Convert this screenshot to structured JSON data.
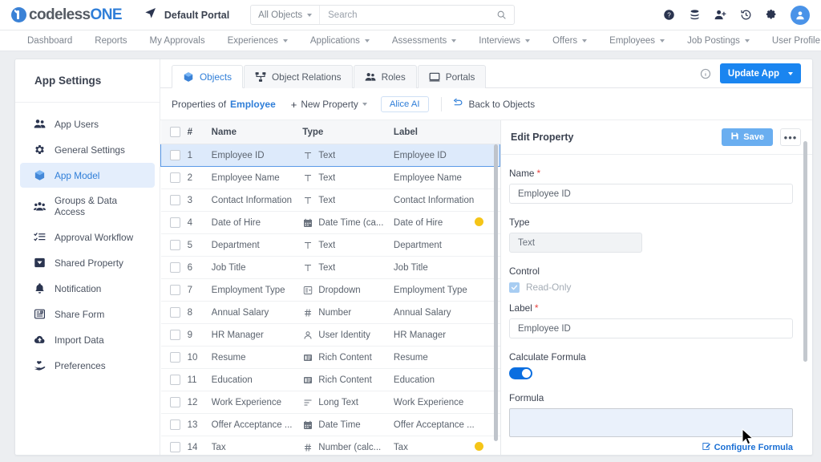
{
  "header": {
    "logo_text_a": "codeless",
    "logo_text_b": "ONE",
    "portal_name": "Default Portal",
    "object_filter": "All Objects",
    "search_placeholder": "Search",
    "icons": [
      "help-circle-icon",
      "database-icon",
      "add-user-icon",
      "history-icon",
      "gear-icon",
      "avatar"
    ]
  },
  "nav": {
    "items": [
      {
        "label": "Dashboard",
        "has_caret": false
      },
      {
        "label": "Reports",
        "has_caret": false
      },
      {
        "label": "My Approvals",
        "has_caret": false
      },
      {
        "label": "Experiences",
        "has_caret": true
      },
      {
        "label": "Applications",
        "has_caret": true
      },
      {
        "label": "Assessments",
        "has_caret": true
      },
      {
        "label": "Interviews",
        "has_caret": true
      },
      {
        "label": "Offers",
        "has_caret": true
      },
      {
        "label": "Employees",
        "has_caret": true
      },
      {
        "label": "Job Postings",
        "has_caret": true
      },
      {
        "label": "User Profile",
        "has_caret": true
      }
    ]
  },
  "sidebar": {
    "title": "App Settings",
    "items": [
      {
        "label": "App Users",
        "icon": "users-icon",
        "active": false
      },
      {
        "label": "General Settings",
        "icon": "gear-icon",
        "active": false
      },
      {
        "label": "App Model",
        "icon": "cube-icon",
        "active": true
      },
      {
        "label": "Groups & Data Access",
        "icon": "group-icon",
        "active": false
      },
      {
        "label": "Approval Workflow",
        "icon": "checklist-icon",
        "active": false
      },
      {
        "label": "Shared Property",
        "icon": "tag-icon",
        "active": false
      },
      {
        "label": "Notification",
        "icon": "bell-icon",
        "active": false
      },
      {
        "label": "Share Form",
        "icon": "form-icon",
        "active": false
      },
      {
        "label": "Import Data",
        "icon": "cloud-upload-icon",
        "active": false
      },
      {
        "label": "Preferences",
        "icon": "hand-heart-icon",
        "active": false
      }
    ]
  },
  "tabs": {
    "items": [
      {
        "label": "Objects",
        "icon": "cube-icon",
        "active": true
      },
      {
        "label": "Object Relations",
        "icon": "relations-icon",
        "active": false
      },
      {
        "label": "Roles",
        "icon": "users-icon",
        "active": false
      },
      {
        "label": "Portals",
        "icon": "monitor-icon",
        "active": false
      }
    ],
    "update_app_label": "Update App"
  },
  "toolbar": {
    "properties_of_label": "Properties of",
    "object_name": "Employee",
    "new_property_label": "New Property",
    "alice_label": "Alice AI",
    "back_label": "Back to Objects"
  },
  "table": {
    "columns": [
      "#",
      "Name",
      "Type",
      "Label"
    ],
    "rows": [
      {
        "num": "1",
        "name": "Employee ID",
        "type": "Text",
        "type_icon": "text-icon",
        "label": "Employee ID",
        "flag": false,
        "selected": true
      },
      {
        "num": "2",
        "name": "Employee Name",
        "type": "Text",
        "type_icon": "text-icon",
        "label": "Employee Name",
        "flag": false,
        "selected": false
      },
      {
        "num": "3",
        "name": "Contact Information",
        "type": "Text",
        "type_icon": "text-icon",
        "label": "Contact Information",
        "flag": false,
        "selected": false
      },
      {
        "num": "4",
        "name": "Date of Hire",
        "type": "Date Time (ca...",
        "type_icon": "calendar-icon",
        "label": "Date of Hire",
        "flag": true,
        "selected": false
      },
      {
        "num": "5",
        "name": "Department",
        "type": "Text",
        "type_icon": "text-icon",
        "label": "Department",
        "flag": false,
        "selected": false
      },
      {
        "num": "6",
        "name": "Job Title",
        "type": "Text",
        "type_icon": "text-icon",
        "label": "Job Title",
        "flag": false,
        "selected": false
      },
      {
        "num": "7",
        "name": "Employment Type",
        "type": "Dropdown",
        "type_icon": "dropdown-icon",
        "label": "Employment Type",
        "flag": false,
        "selected": false
      },
      {
        "num": "8",
        "name": "Annual Salary",
        "type": "Number",
        "type_icon": "number-icon",
        "label": "Annual Salary",
        "flag": false,
        "selected": false
      },
      {
        "num": "9",
        "name": "HR Manager",
        "type": "User Identity",
        "type_icon": "person-icon",
        "label": "HR Manager",
        "flag": false,
        "selected": false
      },
      {
        "num": "10",
        "name": "Resume",
        "type": "Rich Content",
        "type_icon": "rich-text-icon",
        "label": "Resume",
        "flag": false,
        "selected": false
      },
      {
        "num": "11",
        "name": "Education",
        "type": "Rich Content",
        "type_icon": "rich-text-icon",
        "label": "Education",
        "flag": false,
        "selected": false
      },
      {
        "num": "12",
        "name": "Work Experience",
        "type": "Long Text",
        "type_icon": "long-text-icon",
        "label": "Work Experience",
        "flag": false,
        "selected": false
      },
      {
        "num": "13",
        "name": "Offer Acceptance ...",
        "type": "Date Time",
        "type_icon": "calendar-icon",
        "label": "Offer Acceptance ...",
        "flag": false,
        "selected": false
      },
      {
        "num": "14",
        "name": "Tax",
        "type": "Number (calc...",
        "type_icon": "number-icon",
        "label": "Tax",
        "flag": true,
        "selected": false
      }
    ]
  },
  "panel": {
    "title": "Edit Property",
    "save_label": "Save",
    "more_label": "•••",
    "fields": {
      "name_label": "Name",
      "name_value": "Employee ID",
      "type_label": "Type",
      "type_value": "Text",
      "control_label": "Control",
      "readonly_label": "Read-Only",
      "label_label": "Label",
      "label_value": "Employee ID",
      "calculate_formula_label": "Calculate Formula",
      "formula_label": "Formula",
      "formula_value": "",
      "configure_formula_label": "Configure Formula"
    }
  },
  "colors": {
    "accent": "#2f7ed8",
    "primary_button": "#1a85f0",
    "flag_dot": "#f5c518",
    "selected_row": "#ddeafb",
    "toggle_on": "#0a6ee0"
  }
}
